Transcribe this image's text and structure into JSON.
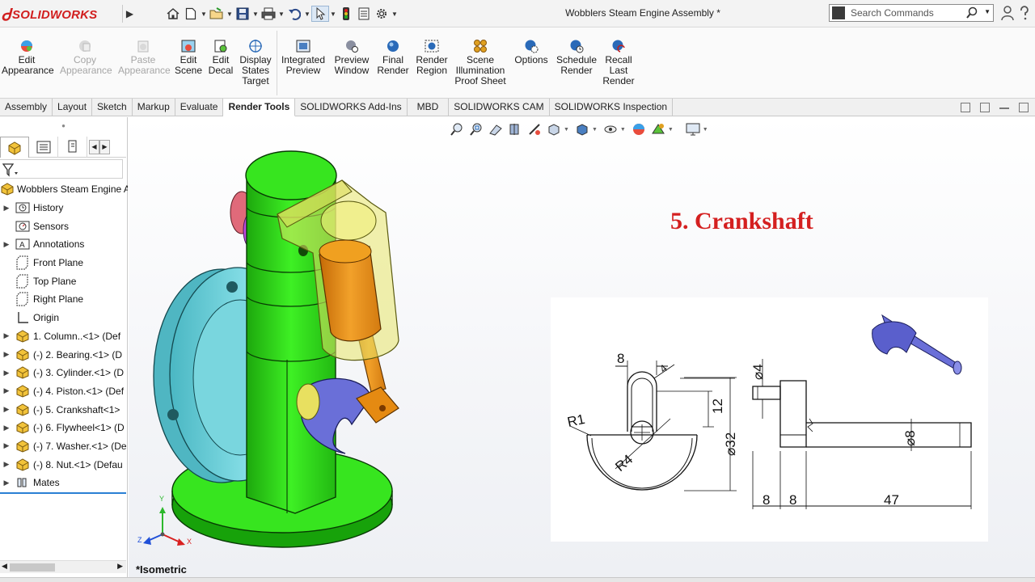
{
  "app": {
    "brand": "SOLIDWORKS",
    "document_title": "Wobblers Steam Engine Assembly *"
  },
  "search": {
    "placeholder": "Search Commands"
  },
  "ribbon": {
    "buttons": [
      {
        "label": "Edit Appearance",
        "enabled": true
      },
      {
        "label": "Copy Appearance",
        "enabled": false
      },
      {
        "label": "Paste Appearance",
        "enabled": false
      },
      {
        "label": "Edit Scene",
        "enabled": true
      },
      {
        "label": "Edit Decal",
        "enabled": true
      },
      {
        "label": "Display States Target",
        "enabled": true
      },
      {
        "label": "Integrated Preview",
        "enabled": true
      },
      {
        "label": "Preview Window",
        "enabled": true
      },
      {
        "label": "Final Render",
        "enabled": true
      },
      {
        "label": "Render Region",
        "enabled": true
      },
      {
        "label": "Scene Illumination Proof Sheet",
        "enabled": true
      },
      {
        "label": "Options",
        "enabled": true
      },
      {
        "label": "Schedule Render",
        "enabled": true
      },
      {
        "label": "Recall Last Render",
        "enabled": true
      }
    ]
  },
  "tabs": [
    "Assembly",
    "Layout",
    "Sketch",
    "Markup",
    "Evaluate",
    "Render Tools",
    "SOLIDWORKS Add-Ins",
    "MBD",
    "SOLIDWORKS CAM",
    "SOLIDWORKS Inspection"
  ],
  "active_tab": "Render Tools",
  "tree": {
    "root": "Wobblers Steam Engine A",
    "items": [
      {
        "label": "History",
        "icon": "history-icon",
        "expandable": true
      },
      {
        "label": "Sensors",
        "icon": "sensors-icon",
        "expandable": false
      },
      {
        "label": "Annotations",
        "icon": "annotations-icon",
        "expandable": true
      },
      {
        "label": "Front Plane",
        "icon": "plane-icon",
        "expandable": false
      },
      {
        "label": "Top Plane",
        "icon": "plane-icon",
        "expandable": false
      },
      {
        "label": "Right Plane",
        "icon": "plane-icon",
        "expandable": false
      },
      {
        "label": "Origin",
        "icon": "origin-icon",
        "expandable": false
      },
      {
        "label": "1. Column..<1> (Def",
        "icon": "part-icon",
        "expandable": true
      },
      {
        "label": "(-) 2. Bearing.<1> (D",
        "icon": "part-icon",
        "expandable": true
      },
      {
        "label": "(-) 3. Cylinder.<1> (D",
        "icon": "part-icon",
        "expandable": true
      },
      {
        "label": "(-) 4. Piston.<1> (Def",
        "icon": "part-icon",
        "expandable": true
      },
      {
        "label": "(-) 5. Crankshaft<1>",
        "icon": "part-icon",
        "expandable": true
      },
      {
        "label": "(-) 6. Flywheel<1> (D",
        "icon": "part-icon",
        "expandable": true
      },
      {
        "label": "(-) 7. Washer.<1> (De",
        "icon": "part-icon",
        "expandable": true
      },
      {
        "label": "(-) 8. Nut.<1> (Defau",
        "icon": "part-icon",
        "expandable": true
      },
      {
        "label": "Mates",
        "icon": "mates-icon",
        "expandable": true
      }
    ]
  },
  "viewport": {
    "overlay_title": "5. Crankshaft",
    "view_label": "*Isometric",
    "triad": {
      "x": "X",
      "y": "Y",
      "z": "Z"
    }
  },
  "drawing": {
    "dims": {
      "width_top": "8",
      "angle_top": "4",
      "height_slot": "12",
      "diameter_outer": "⌀32",
      "radius_r1": "R1",
      "radius_r4": "R4",
      "diameter_pin": "⌀4",
      "diameter_shaft": "⌀8",
      "len_a": "8",
      "len_b": "8",
      "len_c": "47"
    }
  },
  "colors": {
    "brand_red": "#d11f1f",
    "title_red": "#d42020",
    "column_green": "#33e01e",
    "flywheel_cyan": "#6fd3dc",
    "cylinder_yellow": "#e8e66a",
    "piston_orange": "#e58a12",
    "crank_blue": "#6a6fd8"
  }
}
